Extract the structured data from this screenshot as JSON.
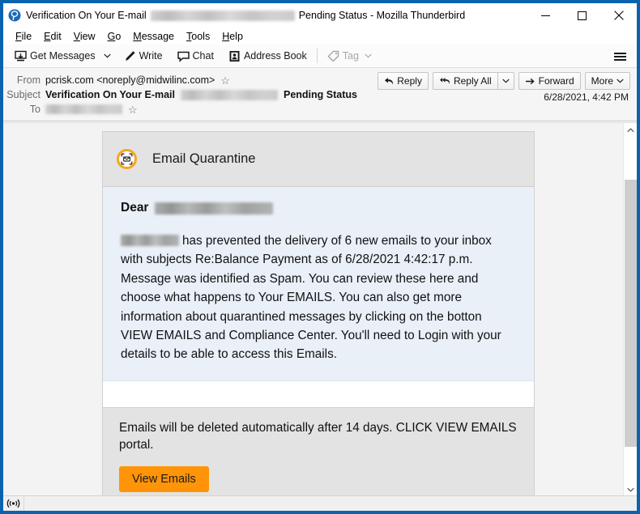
{
  "window": {
    "title_prefix": "Verification On Your E-mail",
    "title_suffix": "Pending Status - Mozilla Thunderbird",
    "app_icon": "thunderbird-icon",
    "controls": {
      "minimize": "minimize-icon",
      "maximize": "maximize-icon",
      "close": "close-icon"
    }
  },
  "menubar": {
    "items": [
      {
        "label": "File",
        "accesskey": "F"
      },
      {
        "label": "Edit",
        "accesskey": "E"
      },
      {
        "label": "View",
        "accesskey": "V"
      },
      {
        "label": "Go",
        "accesskey": "G"
      },
      {
        "label": "Message",
        "accesskey": "M"
      },
      {
        "label": "Tools",
        "accesskey": "T"
      },
      {
        "label": "Help",
        "accesskey": "H"
      }
    ]
  },
  "toolbar": {
    "get_messages": "Get Messages",
    "write": "Write",
    "chat": "Chat",
    "address_book": "Address Book",
    "tag": "Tag",
    "tag_disabled": true,
    "app_menu": "hamburger-icon"
  },
  "message_header": {
    "from_label": "From",
    "from_value": "pcrisk.com <noreply@midwilinc.com>",
    "subject_label": "Subject",
    "subject_before": "Verification On Your E-mail",
    "subject_after": "Pending Status",
    "to_label": "To",
    "to_value_redacted": true,
    "date": "6/28/2021, 4:42 PM",
    "actions": {
      "reply": "Reply",
      "reply_all": "Reply All",
      "forward": "Forward",
      "more": "More"
    }
  },
  "email": {
    "card_title": "Email Quarantine",
    "card_icon": "quarantine-badge-icon",
    "greeting_label": "Dear",
    "greeting_redacted": true,
    "body_text": "has prevented the delivery of 6 new emails to your inbox with subjects Re:Balance Payment as of 6/28/2021 4:42:17 p.m. Message was identified as Spam. You can review these here and choose what happens to Your EMAILS. You can also get more information about quarantined messages by clicking on the botton VIEW EMAILS and Compliance Center. You'll need to Login with your details to be able to access this Emails.",
    "footer_text": "Emails will be deleted automatically after 14 days. CLICK VIEW EMAILS portal.",
    "view_button": "View Emails",
    "colors": {
      "accent_orange": "#ff9408",
      "icon_ring": "#f5a623",
      "body_bg": "#e9f0f8",
      "header_bg": "#e3e3e3"
    }
  },
  "scrollbar": {
    "up_arrow": "chevron-up-icon",
    "down_arrow": "chevron-down-icon"
  },
  "statusbar": {
    "network_icon": "broadcast-icon"
  }
}
